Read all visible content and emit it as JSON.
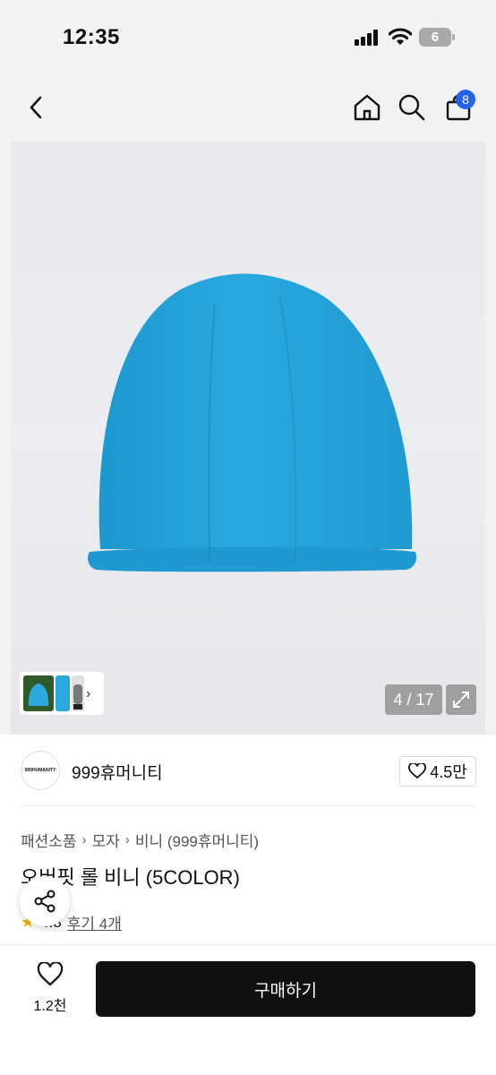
{
  "status_bar": {
    "time": "12:35",
    "battery": "6"
  },
  "header": {
    "cart_count": "8"
  },
  "gallery": {
    "counter": "4 / 17"
  },
  "seller": {
    "logo_text": "999HUMANITY",
    "name": "999휴머니티",
    "likes": "4.5만"
  },
  "breadcrumb": [
    "패션소품",
    "모자",
    "비니 (999휴머니티)"
  ],
  "product": {
    "title": "오버핏 롤 비니 (5COLOR)",
    "rating": "4.8",
    "reviews": "후기 4개",
    "accent_color": "#27a6d9"
  },
  "bottom_bar": {
    "wish_count": "1.2천",
    "buy_label": "구매하기"
  }
}
